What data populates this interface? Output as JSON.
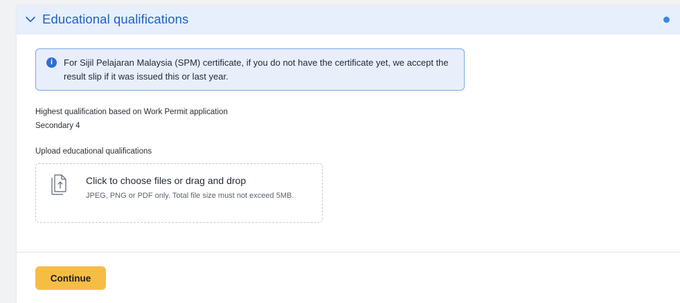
{
  "section": {
    "title": "Educational qualifications",
    "chevron_icon": "chevron-down-icon",
    "status_icon": "status-dot-icon",
    "accent_color": "#1f62c0"
  },
  "info_banner": {
    "icon": "info-icon",
    "text": "For Sijil Pelajaran Malaysia (SPM) certificate, if you do not have the certificate yet, we accept the result slip if it was issued this or last year."
  },
  "highest_qualification": {
    "label": "Highest qualification based on Work Permit application",
    "value": "Secondary 4"
  },
  "upload": {
    "label": "Upload educational qualifications",
    "icon": "file-upload-icon",
    "title": "Click to choose files or drag and drop",
    "hint": "JPEG, PNG or PDF only. Total file size must not exceed 5MB."
  },
  "footer": {
    "continue_label": "Continue",
    "button_color": "#f6bd45"
  }
}
